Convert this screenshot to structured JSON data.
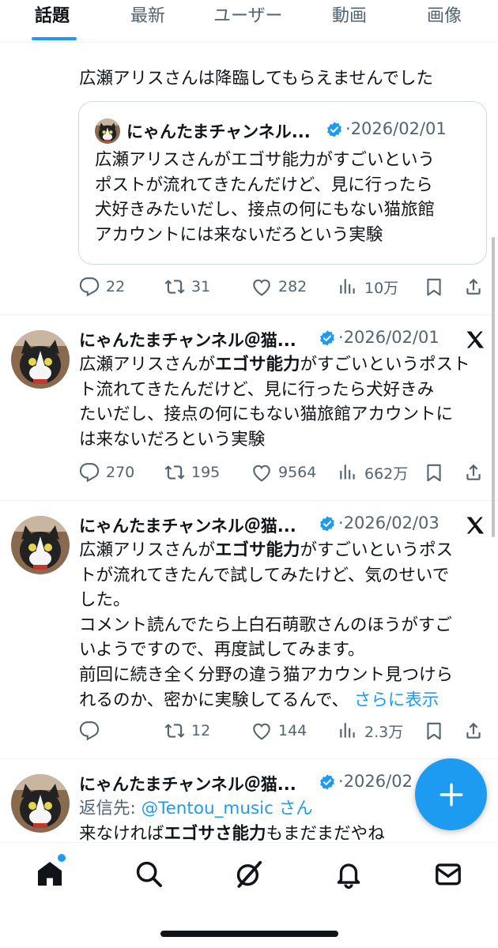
{
  "tabs": [
    "話題",
    "最新",
    "ユーザー",
    "動画",
    "画像"
  ],
  "post1": {
    "text": "広瀬アリスさんは降臨してもらえませんでした",
    "quote": {
      "name": "にゃんたまチャンネル...",
      "date": "2026/02/01",
      "lines": [
        "広瀬アリスさんがエゴサ能力がすごいという",
        "ポストが流れてきたんだけど、見に行ったら",
        "犬好きみたいだし、接点の何にもない猫旅館",
        "アカウントには来ないだろという実験"
      ]
    },
    "replies": "22",
    "reposts": "31",
    "likes": "282",
    "views": "10万"
  },
  "post2": {
    "name": "にゃんたまチャンネル＠猫...",
    "date": "2026/02/01",
    "lines": [
      [
        "広瀬アリスさんが",
        "エゴサ能力",
        "がすごいというポスト"
      ],
      "ト流れてきたんだけど、見に行ったら犬好きみ",
      "たいだし、接点の何にもない猫旅館アカウントに",
      "は来ないだろという実験"
    ],
    "replies": "270",
    "reposts": "195",
    "likes": "9564",
    "views": "662万"
  },
  "post3": {
    "name": "にゃんたまチャンネル＠猫...",
    "date": "2026/02/03",
    "lines": [
      [
        "広瀬アリスさんが",
        "エゴサ能力",
        "がすごいというポス"
      ],
      "トが流れてきたんで試してみたけど、気のせいで",
      "した。",
      "コメント読んでたら上白石萌歌さんのほうがすご",
      "いようですので、再度試してみます。",
      "前回に続き全く分野の違う猫アカウント見つけら",
      "れるのか、密かに実験してるんで、"
    ],
    "show_more": "さらに表示",
    "replies": "",
    "reposts": "12",
    "likes": "144",
    "views": "2.3万"
  },
  "post4": {
    "name": "にゃんたまチャンネル＠猫...",
    "date": "2026/02",
    "reply_prefix": "返信先: ",
    "reply_handle": "@Tentou_music",
    "reply_suffix": " さん",
    "partial_line": [
      "来なければ",
      "エゴサさ能力",
      "もまだまだやね"
    ]
  },
  "colors": {
    "accent": "#1d9bf0",
    "text": "#0f1419",
    "secondary": "#536471"
  }
}
